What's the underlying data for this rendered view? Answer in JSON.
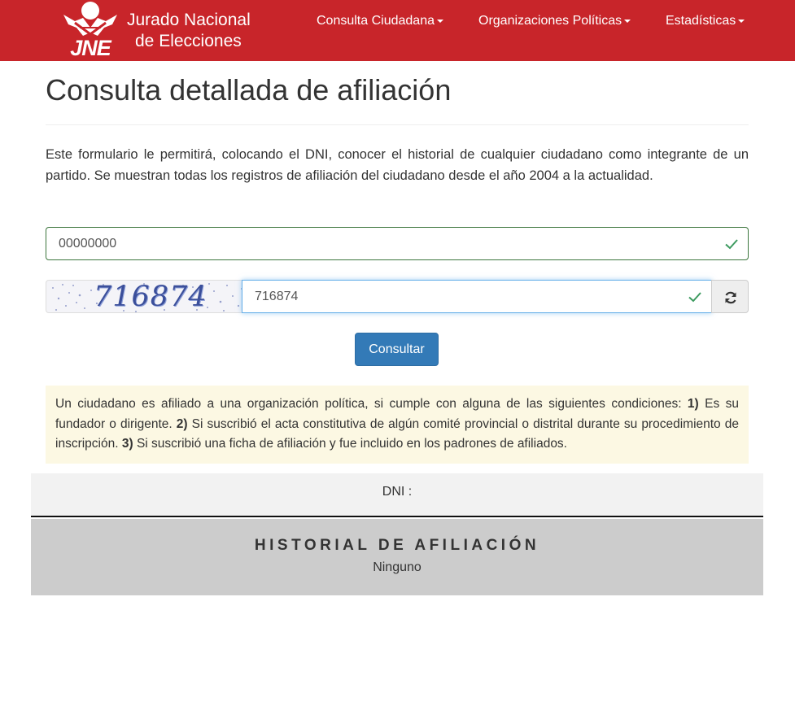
{
  "header": {
    "logo_text": "JNE",
    "brand_line1": "Jurado Nacional",
    "brand_line2": "de Elecciones",
    "nav": [
      {
        "label": "Consulta Ciudadana"
      },
      {
        "label": "Organizaciones Políticas"
      },
      {
        "label": "Estadísticas"
      }
    ],
    "color": "#c8252a"
  },
  "page": {
    "title": "Consulta detallada de afiliación",
    "intro": "Este formulario le permitirá, colocando el DNI, conocer el historial de cualquier ciudadano como integrante de un partido. Se muestran todas los registros de afiliación del ciudadano desde el año 2004 a la actualidad."
  },
  "form": {
    "dni_value": "00000000",
    "captcha_image_text": "716874",
    "captcha_value": "716874",
    "submit_label": "Consultar",
    "valid_icon": "check-icon",
    "refresh_icon": "refresh-icon"
  },
  "notice": {
    "part1": "Un ciudadano es afiliado a una organización política, si cumple con alguna de las siguientes condiciones: ",
    "n1": "1)",
    "part2": " Es su fundador o dirigente. ",
    "n2": "2)",
    "part3": " Si suscribió el acta constitutiva de algún comité provincial o distrital durante su procedimiento de inscripción. ",
    "n3": "3)",
    "part4": " Si suscribió una ficha de afiliación y fue incluido en los padrones de afiliados."
  },
  "result": {
    "dni_label": "DNI :",
    "history_title": "HISTORIAL DE AFILIACIÓN",
    "history_value": "Ninguno"
  }
}
